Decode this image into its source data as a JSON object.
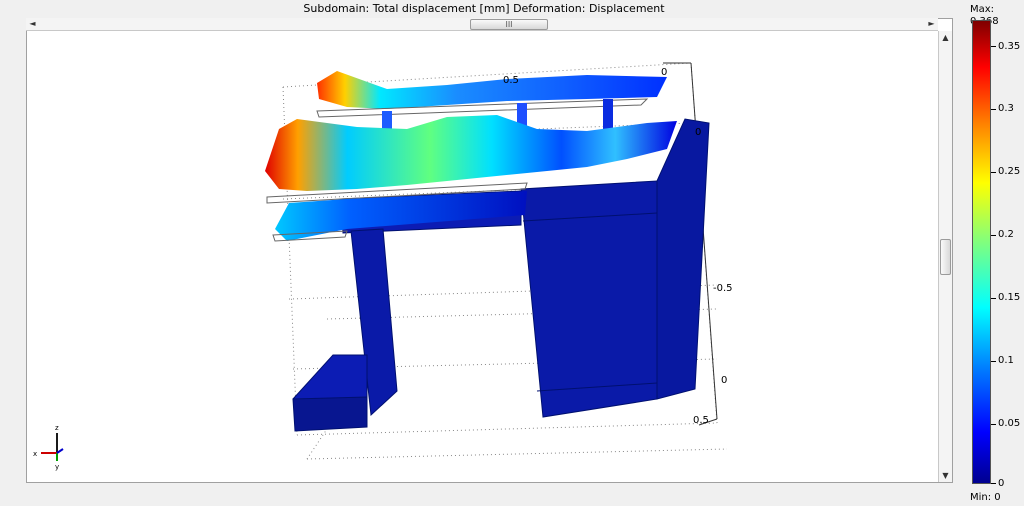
{
  "plot": {
    "title": "Subdomain: Total displacement [mm]   Deformation: Displacement",
    "axis_ticks": {
      "top_mid": "0.5",
      "top_right": "0",
      "right_top": "0",
      "right_mid": "-0.5",
      "right_bottom_0": "0",
      "right_bottom_05": "0.5"
    },
    "triad": {
      "z": "z",
      "x": "x",
      "y": "y"
    }
  },
  "colorbar": {
    "max_label": "Max: 0.368",
    "min_label": "Min: 0",
    "ticks": [
      "0.35",
      "0.3",
      "0.25",
      "0.2",
      "0.15",
      "0.1",
      "0.05",
      "0"
    ],
    "colors": {
      "low": "#00008f",
      "mid": "#00ffff",
      "high": "#7f0000"
    }
  },
  "scrollbars": {
    "h_thumb_grip": "III",
    "left_arrow": "◄",
    "right_arrow": "►",
    "up_arrow": "▲",
    "down_arrow": "▼"
  }
}
